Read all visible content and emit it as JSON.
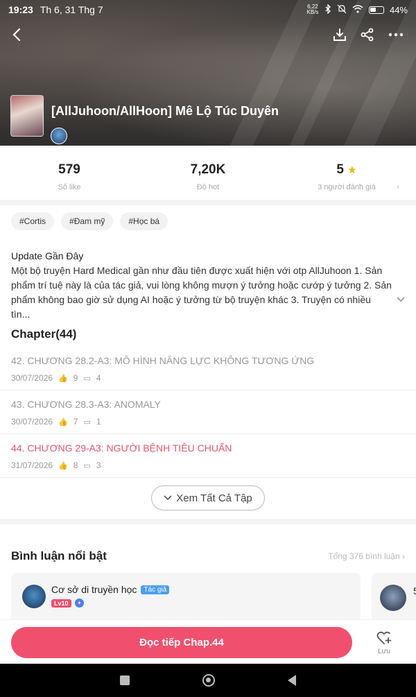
{
  "status_bar": {
    "time": "19:23",
    "date": "Th 6, 31 Thg 7",
    "net_speed": "6,22 KB/s",
    "battery": "44%"
  },
  "story": {
    "title": "[AllJuhoon/AllHoon] Mê Lộ Túc Duyên"
  },
  "stats": [
    {
      "value": "579",
      "label": "Số like"
    },
    {
      "value": "7,20K",
      "label": "Độ hot"
    },
    {
      "value": "5",
      "label": "3 người đánh giá"
    }
  ],
  "tags": [
    "#Cortis",
    "#Đam mỹ",
    "#Học bá"
  ],
  "update": {
    "title": "Update Gần Đây",
    "description": "Một bộ truyện Hard Medical gần như đầu tiên được xuất hiện với otp AllJuhoon 1. Sản phẩm trí tuệ này là của tác giả, vui lòng không mượn ý tưởng hoặc cướp ý tưởng 2. Sản phẩm không bao giờ sử dụng AI hoặc ý tưởng từ bộ truyện khác 3. Truyện có nhiều tìn..."
  },
  "chapters": {
    "heading": "Chapter(44)",
    "items": [
      {
        "title": "42. CHƯƠNG 28.2-A3: MÔ HÌNH NĂNG LỰC KHÔNG TƯƠNG ỨNG",
        "date": "30/07/2026",
        "likes": "9",
        "comments": "4"
      },
      {
        "title": "43. CHƯƠNG 28.3-A3: ANOMALY",
        "date": "30/07/2026",
        "likes": "7",
        "comments": "1"
      },
      {
        "title": "44. CHƯƠNG 29-A3: NGƯỜI BỆNH TIÊU CHUẨN",
        "date": "31/07/2026",
        "likes": "8",
        "comments": "3"
      }
    ],
    "see_all": "Xem Tất Cả Tập"
  },
  "comments": {
    "heading": "Bình luận nổi bật",
    "total": "Tổng 376 bình luận",
    "first": {
      "name": "Cơ sở di truyền học",
      "badge": "Tác giả",
      "level": "Lv10"
    },
    "second_name_fragment": "5"
  },
  "bottom": {
    "read_label": "Đọc tiếp Chap.44",
    "save_label": "Lưu"
  },
  "colors": {
    "accent": "#f0506e",
    "active_chapter": "#e8566c",
    "star": "#f5b400",
    "author_badge": "#4d9df0"
  }
}
